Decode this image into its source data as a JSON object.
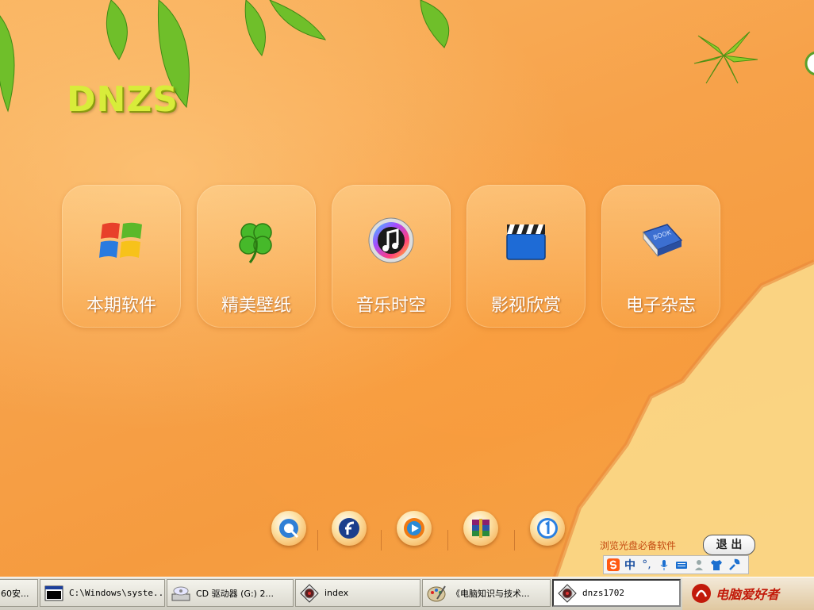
{
  "app": {
    "logo_text": "DNZS"
  },
  "tiles": [
    {
      "label": "本期软件",
      "icon": "windows-logo-icon"
    },
    {
      "label": "精美壁纸",
      "icon": "clover-icon"
    },
    {
      "label": "音乐时空",
      "icon": "music-note-icon"
    },
    {
      "label": "影视欣赏",
      "icon": "clapperboard-icon"
    },
    {
      "label": "电子杂志",
      "icon": "book-icon"
    }
  ],
  "dock": [
    {
      "icon": "quicktime-icon"
    },
    {
      "icon": "flash-player-icon"
    },
    {
      "icon": "media-player-icon"
    },
    {
      "icon": "winrar-icon"
    },
    {
      "icon": "info-1-icon"
    }
  ],
  "footer": {
    "promo_text": "浏览光盘必备软件",
    "exit_label": "退 出"
  },
  "ime": {
    "mode_label": "中"
  },
  "taskbar": {
    "items": [
      {
        "label": "60安...",
        "icon": "app-icon"
      },
      {
        "label": "C:\\Windows\\syste...",
        "icon": "console-icon"
      },
      {
        "label": "CD 驱动器 (G:) 2...",
        "icon": "cd-drive-icon"
      },
      {
        "label": "index",
        "icon": "dnzs-app-icon"
      },
      {
        "label": "《电脑知识与技术...",
        "icon": "paint-icon"
      },
      {
        "label": "dnzs1702",
        "icon": "dnzs-app-icon",
        "active": true
      }
    ],
    "tray_logo": "电脑爱好者"
  },
  "colors": {
    "accent": "#f59b3f",
    "logo": "#d8ec3a"
  }
}
